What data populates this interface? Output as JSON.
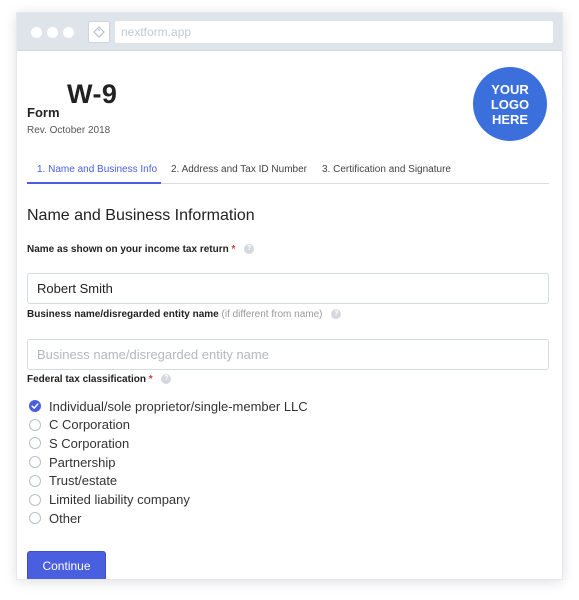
{
  "browser": {
    "url": "nextform.app"
  },
  "form": {
    "word": "Form",
    "code": "W-9",
    "revision": "Rev. October 2018",
    "logo_lines": [
      "YOUR",
      "LOGO",
      "HERE"
    ],
    "logo_color": "#3b6fdc"
  },
  "tabs": [
    {
      "label": "1. Name and Business Info",
      "active": true
    },
    {
      "label": "2. Address and Tax ID Number",
      "active": false
    },
    {
      "label": "3. Certification and Signature",
      "active": false
    }
  ],
  "section": {
    "title": "Name and Business Information"
  },
  "fields": {
    "name": {
      "label": "Name as shown on your income tax return",
      "required_mark": "*",
      "value": "Robert Smith"
    },
    "business": {
      "label": "Business name/disregarded entity name",
      "hint": "(if different from name)",
      "placeholder": "Business name/disregarded entity name",
      "value": ""
    },
    "classification": {
      "label": "Federal tax classification",
      "required_mark": "*",
      "selected": "Individual/sole proprietor/single-member LLC",
      "options": [
        "Individual/sole proprietor/single-member LLC",
        "C Corporation",
        "S Corporation",
        "Partnership",
        "Trust/estate",
        "Limited liability company",
        "Other"
      ]
    }
  },
  "actions": {
    "continue_label": "Continue"
  },
  "colors": {
    "accent": "#4a5ee0",
    "required": "#d9363e"
  }
}
